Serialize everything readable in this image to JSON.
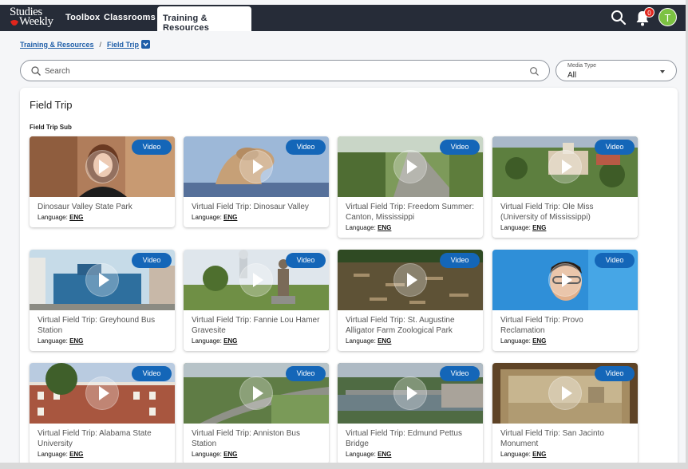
{
  "header": {
    "logo_line1": "Studies",
    "logo_line2": "Weekly",
    "nav": [
      {
        "label": "Toolbox"
      },
      {
        "label": "Classrooms"
      },
      {
        "label": "Training & Resources"
      }
    ],
    "notification_count": "0",
    "avatar_initial": "T",
    "icons": [
      "search-icon",
      "bell-icon"
    ]
  },
  "breadcrumb": {
    "items": [
      "Training & Resources",
      "Field Trip"
    ],
    "separator": "/"
  },
  "search": {
    "placeholder": "Search",
    "value": ""
  },
  "filter": {
    "label": "Media Type",
    "value": "All"
  },
  "panel": {
    "title": "Field Trip",
    "subtitle": "Field Trip Sub"
  },
  "language_label": "Language:",
  "cards": [
    {
      "title": "Dinosaur Valley State Park",
      "badge": "Video",
      "lang": "ENG",
      "scene": "person"
    },
    {
      "title": "Virtual Field Trip: Dinosaur Valley",
      "badge": "Video",
      "lang": "ENG",
      "scene": "dino"
    },
    {
      "title": "Virtual Field Trip: Freedom Summer: Canton, Mississippi",
      "badge": "Video",
      "lang": "ENG",
      "scene": "road"
    },
    {
      "title": "Virtual Field Trip: Ole Miss (University of Mississippi)",
      "badge": "Video",
      "lang": "ENG",
      "scene": "campus"
    },
    {
      "title": "Virtual Field Trip: Greyhound Bus Station",
      "badge": "Video",
      "lang": "ENG",
      "scene": "building"
    },
    {
      "title": "Virtual Field Trip: Fannie Lou Hamer Gravesite",
      "badge": "Video",
      "lang": "ENG",
      "scene": "statue"
    },
    {
      "title": "Virtual Field Trip: St. Augustine Alligator Farm Zoological Park",
      "badge": "Video",
      "lang": "ENG",
      "scene": "gators"
    },
    {
      "title": "Virtual Field Trip: Provo Reclamation",
      "badge": "Video",
      "lang": "ENG",
      "scene": "boy"
    },
    {
      "title": "Virtual Field Trip: Alabama State University",
      "badge": "Video",
      "lang": "ENG",
      "scene": "brick"
    },
    {
      "title": "Virtual Field Trip: Anniston Bus Station",
      "badge": "Video",
      "lang": "ENG",
      "scene": "aerial"
    },
    {
      "title": "Virtual Field Trip: Edmund Pettus Bridge",
      "badge": "Video",
      "lang": "ENG",
      "scene": "bridge"
    },
    {
      "title": "Virtual Field Trip: San Jacinto Monument",
      "badge": "Video",
      "lang": "ENG",
      "scene": "painting"
    }
  ]
}
